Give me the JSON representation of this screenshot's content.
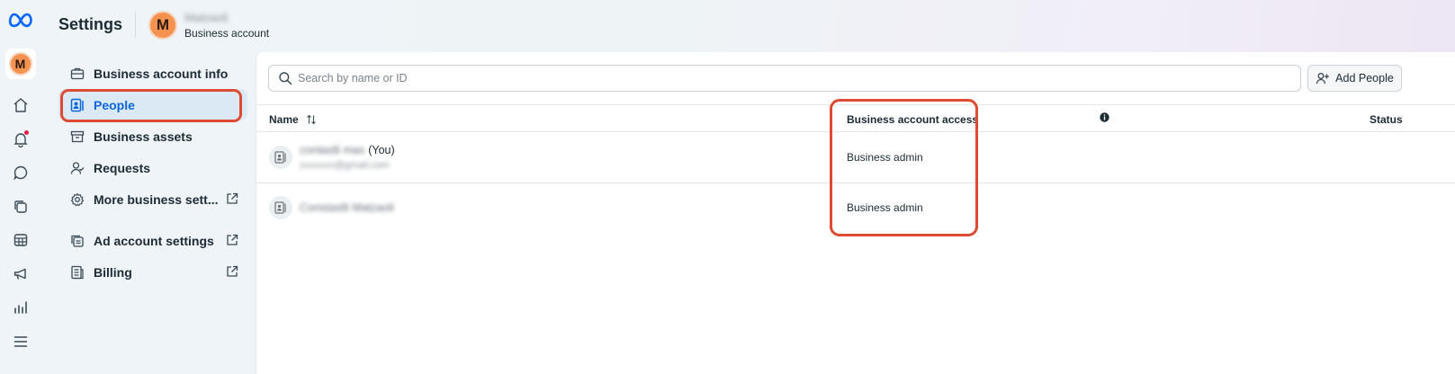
{
  "header": {
    "title": "Settings",
    "avatar_letter": "M",
    "account_name": "Matzaoli",
    "account_type": "Business account"
  },
  "rail": {
    "avatar_letter": "M",
    "icons": [
      "home-icon",
      "bell-icon",
      "chat-icon",
      "pages-icon",
      "table-icon",
      "megaphone-icon",
      "chart-icon",
      "menu-icon"
    ],
    "notification_dot_color": "#e41e3f"
  },
  "nav": {
    "items": [
      {
        "label": "Business account info",
        "icon": "briefcase-icon"
      },
      {
        "label": "People",
        "icon": "people-icon",
        "active": true
      },
      {
        "label": "Business assets",
        "icon": "archive-icon"
      },
      {
        "label": "Requests",
        "icon": "person-check-icon"
      },
      {
        "label": "More business sett...",
        "icon": "gear-icon",
        "external": true
      },
      {
        "label": "Ad account settings",
        "icon": "ad-account-icon",
        "external": true
      },
      {
        "label": "Billing",
        "icon": "billing-icon",
        "external": true
      }
    ]
  },
  "search": {
    "placeholder": "Search by name or ID",
    "value": ""
  },
  "add_people": {
    "label": "Add People"
  },
  "table": {
    "columns": {
      "name": "Name",
      "access": "Business account access",
      "status": "Status"
    },
    "rows": [
      {
        "name": "conlastli mas",
        "suffix": "(You)",
        "email": "xxxxxxx@gmail.com",
        "access": "Business admin"
      },
      {
        "name": "Constastli Matzaoli",
        "suffix": "",
        "email": "",
        "access": "Business admin"
      }
    ]
  },
  "colors": {
    "accent": "#0a66d8",
    "highlight": "#dc4b32",
    "avatar": "#f6924f"
  }
}
